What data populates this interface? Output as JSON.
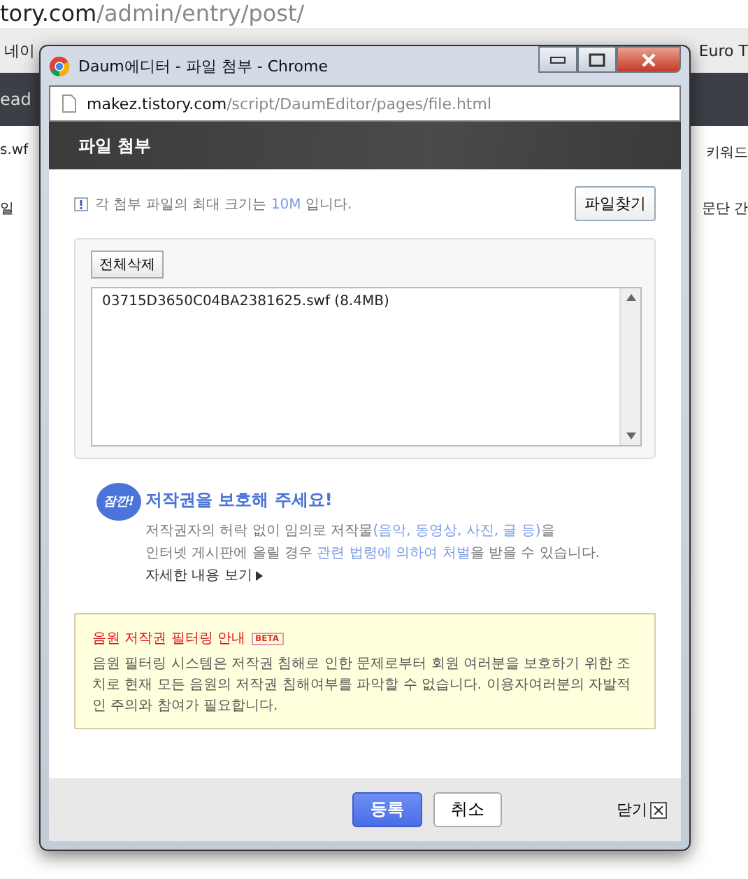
{
  "browser": {
    "url_host": "tory.com",
    "url_path": "/admin/entry/post/",
    "bookmarks": [
      "네이",
      "Euro T"
    ],
    "toolbar_text": "ead",
    "editor_left": [
      "s.wf",
      "일"
    ],
    "editor_right": [
      "키워드",
      "문단 간"
    ]
  },
  "popup": {
    "title": "Daum에디터 - 파일 첨부 - Chrome",
    "url_host": "makez.tistory.com",
    "url_path": "/script/DaumEditor/pages/file.html",
    "header": "파일 첨부",
    "notice": [
      {
        "text": "각 첨부 파일의 최대 크기는 ",
        "highlight": false
      },
      {
        "text": "10M",
        "highlight": true
      },
      {
        "text": " 입니다.",
        "highlight": false
      }
    ],
    "find_button": "파일찾기",
    "delete_all_button": "전체삭제",
    "files": [
      {
        "name": "03715D3650C04BA2381625.swf (8.4MB)",
        "selected": false
      }
    ],
    "copyright": {
      "badge": "잠깐!",
      "title": "저작권을 보호해 주세요!",
      "lines": [
        [
          {
            "text": "저작권자의 허락 없이 임의로 저작물",
            "highlight": false
          },
          {
            "text": "(음악, 동영상, 사진, 글 등)",
            "highlight": true
          },
          {
            "text": "을",
            "highlight": false
          }
        ],
        [
          {
            "text": "인터넷 게시판에 올릴 경우 ",
            "highlight": false
          },
          {
            "text": "관련 법령에 의하여 처벌",
            "highlight": true
          },
          {
            "text": "을 받을 수 있습니다.",
            "highlight": false
          }
        ]
      ],
      "more_link": "자세한 내용 보기"
    },
    "filter": {
      "title": "음원 저작권 필터링 안내",
      "badge": "BETA",
      "body": "음원 필터링 시스템은 저작권 침해로 인한 문제로부터 회원 여러분을 보호하기 위한 조치로 현재 모든 음원의 저작권 침해여부를 파악할 수 없습니다. 이용자여러분의 자발적인 주의와 참여가 필요합니다."
    },
    "confirm_button": "등록",
    "cancel_button": "취소",
    "close_button": "닫기"
  }
}
